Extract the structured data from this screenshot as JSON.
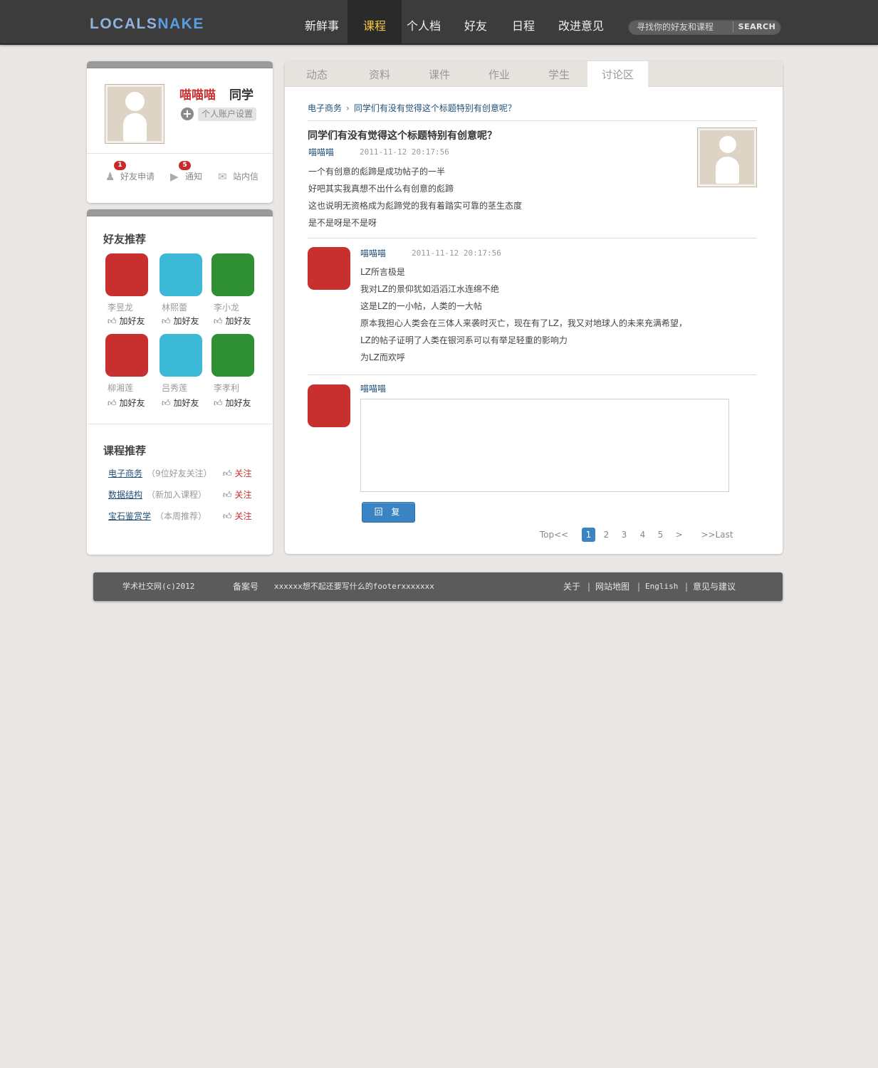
{
  "header": {
    "logo_part1": "LOCALS",
    "logo_part2": "NAKE",
    "nav": [
      "新鲜事",
      "课程",
      "个人档",
      "好友",
      "日程",
      "改进意见"
    ],
    "active_nav": "课程",
    "search_placeholder": "寻找你的好友和课程",
    "search_button": "SEARCH"
  },
  "profile": {
    "name": "喵喵喵",
    "role": "同学",
    "settings_label": "个人账户设置",
    "quick": [
      {
        "label": "好友申请",
        "badge": "1",
        "icon": "add-user-icon"
      },
      {
        "label": "通知",
        "badge": "5",
        "icon": "notification-icon"
      },
      {
        "label": "站内信",
        "badge": "",
        "icon": "mail-icon"
      }
    ]
  },
  "friends": {
    "title": "好友推荐",
    "add_label": "加好友",
    "items": [
      {
        "name": "李昱龙",
        "color": "#c83030"
      },
      {
        "name": "林熙蕾",
        "color": "#3bb9d6"
      },
      {
        "name": "李小龙",
        "color": "#2e8f33"
      },
      {
        "name": "柳湘莲",
        "color": "#c83030"
      },
      {
        "name": "吕秀莲",
        "color": "#3bb9d6"
      },
      {
        "name": "李孝利",
        "color": "#2e8f33"
      }
    ]
  },
  "courses": {
    "title": "课程推荐",
    "follow_label": "关注",
    "items": [
      {
        "name": "电子商务",
        "note": "（9位好友关注）"
      },
      {
        "name": "数据结构",
        "note": "（新加入课程）"
      },
      {
        "name": "宝石鉴赏学",
        "note": "（本周推荐）"
      }
    ]
  },
  "tabs": [
    "动态",
    "资料",
    "课件",
    "作业",
    "学生",
    "讨论区"
  ],
  "active_tab": "讨论区",
  "breadcrumb": {
    "course": "电子商务",
    "topic": "同学们有没有觉得这个标题特别有创意呢？"
  },
  "post": {
    "title": "同学们有没有觉得这个标题特别有创意呢？",
    "author": "喵喵喵",
    "time": "2011-11-12 20:17:56",
    "lines": [
      "一个有创意的彪蹄是成功帖子的一半",
      "好吧其实我真想不出什么有创意的彪蹄",
      "这也说明无资格成为彪蹄党的我有着踏实可靠的茎生态度",
      "是不是呀是不是呀"
    ]
  },
  "reply": {
    "author": "喵喵喵",
    "time": "2011-11-12 20:17:56",
    "lines": [
      "LZ所言极是",
      "我对LZ的景仰犹如滔滔江水连绵不绝",
      "这是LZ的一小帖，人类的一大帖",
      "原本我担心人类会在三体人来袭时灭亡，现在有了LZ，我又对地球人的未来充满希望，",
      "LZ的帖子证明了人类在银河系可以有举足轻重的影响力",
      "为LZ而欢呼"
    ]
  },
  "compose": {
    "author": "喵喵喵",
    "button": "回 复"
  },
  "pagination": {
    "first": "Top<<",
    "pages": [
      "1",
      "2",
      "3",
      "4",
      "5"
    ],
    "current": "1",
    "next": ">",
    "last": ">>Last"
  },
  "footer": {
    "copyright": "学术社交网(c)2012",
    "icp": "备案号",
    "filler": "xxxxxx想不起还要写什么的footerxxxxxxx",
    "links": [
      "关于",
      "网站地图",
      "English",
      "意见与建议"
    ]
  }
}
